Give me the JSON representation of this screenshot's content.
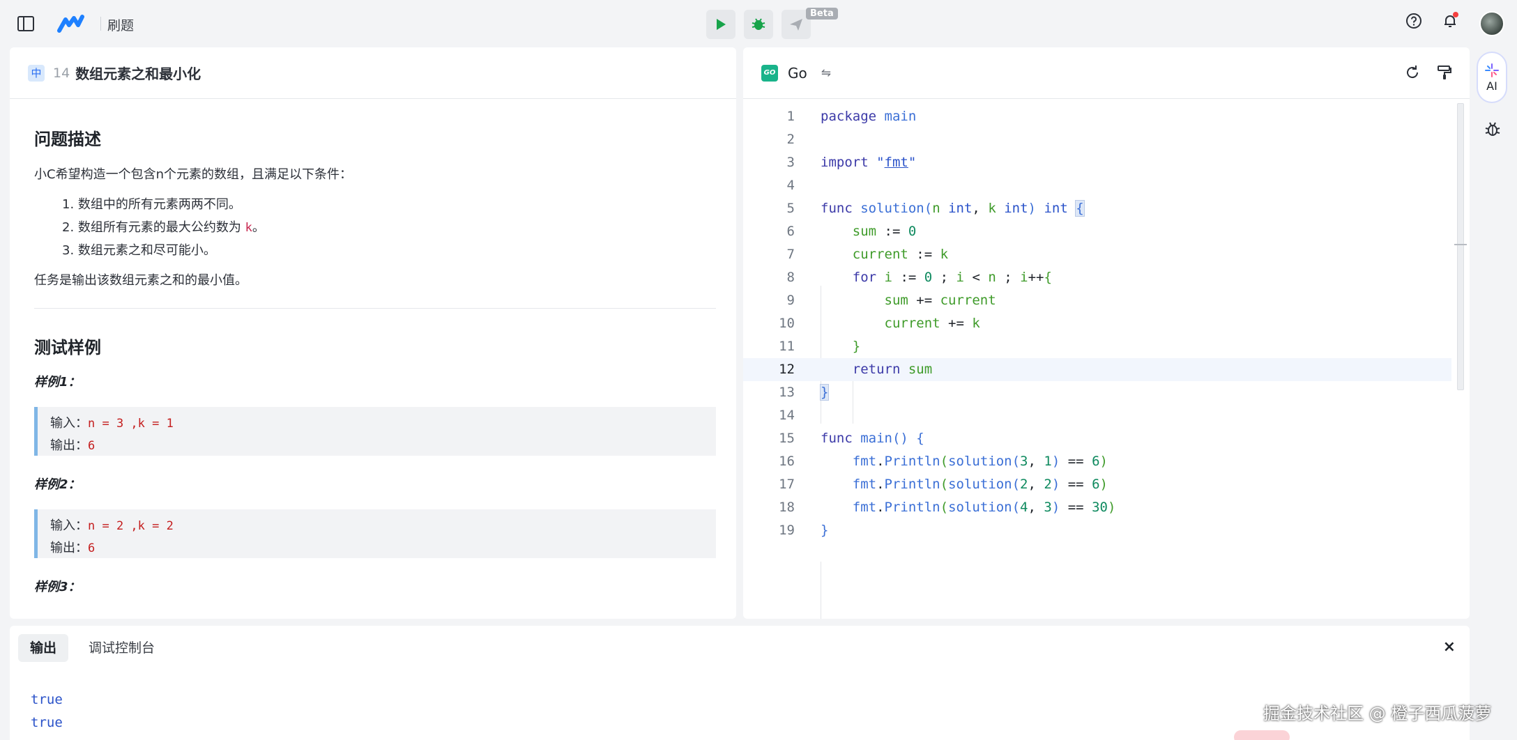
{
  "header": {
    "app_title": "刷题",
    "beta_label": "Beta",
    "icons": [
      "sidebar-toggle-icon",
      "logo",
      "run-icon",
      "debug-icon",
      "submit-icon",
      "help-icon",
      "bell-icon",
      "avatar"
    ]
  },
  "problem": {
    "difficulty": "中",
    "number": "14",
    "title": "数组元素之和最小化",
    "description_heading": "问题描述",
    "intro": "小C希望构造一个包含n个元素的数组，且满足以下条件：",
    "conditions": [
      {
        "text": "1. 数组中的所有元素两两不同。",
        "code": "",
        "suffix": ""
      },
      {
        "text": "2. 数组所有元素的最大公约数为 ",
        "code": "k",
        "suffix": "。"
      },
      {
        "text": "3. 数组元素之和尽可能小。",
        "code": "",
        "suffix": ""
      }
    ],
    "task": "任务是输出该数组元素之和的最小值。",
    "examples_heading": "测试样例",
    "examples": [
      {
        "label": "样例1：",
        "input_label": "输入：",
        "input": "n = 3 ,k = 1",
        "output_label": "输出：",
        "output": "6"
      },
      {
        "label": "样例2：",
        "input_label": "输入：",
        "input": "n = 2 ,k = 2",
        "output_label": "输出：",
        "output": "6"
      },
      {
        "label": "样例3："
      }
    ]
  },
  "editor": {
    "language": "Go",
    "language_icon_text": "GO",
    "swap_glyph": "⇋",
    "active_line": 12,
    "line_numbers": [
      "1",
      "2",
      "3",
      "4",
      "5",
      "6",
      "7",
      "8",
      "9",
      "10",
      "11",
      "12",
      "13",
      "14",
      "15",
      "16",
      "17",
      "18",
      "19"
    ]
  },
  "right_rail": {
    "ai_label": "AI"
  },
  "output": {
    "tabs": [
      "输出",
      "调试控制台"
    ],
    "active_tab": 0,
    "close_glyph": "×",
    "lines": [
      "true",
      "true"
    ]
  },
  "watermark": "掘金技术社区 @ 橙子西瓜菠萝",
  "colors": {
    "accent": "#2b6ff2",
    "run_green": "#17a34a",
    "keyword": "#3c3aa8",
    "variable": "#3f9b2a"
  }
}
